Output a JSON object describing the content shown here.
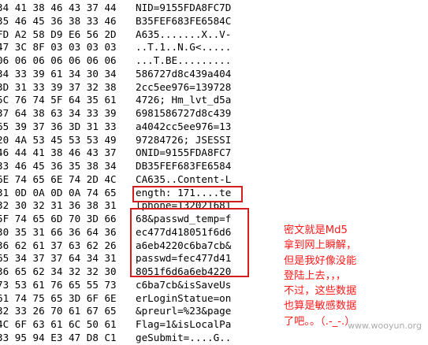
{
  "hex_rows": [
    {
      "hex": "34 41 38 46 43 37 44",
      "ascii": "NID=9155FDA8FC7D"
    },
    {
      "hex": "35 46 45 36 38 33 46",
      "ascii": "B35FEF683FE6584C"
    },
    {
      "hex": "FD A2 58 D9 E6 56 2D",
      "ascii": "A635.......X..V-"
    },
    {
      "hex": "47 3C 8F 03 03 03 03",
      "ascii": "..T.1..N.G<....."
    },
    {
      "hex": "06 06 06 06 06 06 06",
      "ascii": "...T.BE........."
    },
    {
      "hex": "34 33 39 61 34 30 34",
      "ascii": "586727d8c439a404"
    },
    {
      "hex": "3D 31 33 39 37 32 38",
      "ascii": "2cc5ee976=139728"
    },
    {
      "hex": "5C 76 74 5F 64 35 61",
      "ascii": "4726; Hm_lvt_d5a"
    },
    {
      "hex": "37 64 38 63 34 33 39",
      "ascii": "6981586727d8c439"
    },
    {
      "hex": "65 39 37 36 3D 31 33",
      "ascii": "a4042cc5ee976=13"
    },
    {
      "hex": "20 4A 53 45 53 53 49",
      "ascii": "97284726; JSESSI"
    },
    {
      "hex": "46 44 41 38 46 43 37",
      "ascii": "ONID=9155FDA8FC7"
    },
    {
      "hex": "33 46 45 36 35 38 34",
      "ascii": "DB35FEF683FE6584"
    },
    {
      "hex": "6E 74 65 6E 74 2D 4C",
      "ascii": "CA635..Content-L"
    },
    {
      "hex": "31 0D 0A 0D 0A 74 65",
      "ascii": "ength: 171....te"
    },
    {
      "hex": "32 30 32 31 36 38 31",
      "ascii": "lphone=132021681"
    },
    {
      "hex": "5F 74 65 6D 70 3D 66",
      "ascii": "68&passwd_temp=f"
    },
    {
      "hex": "30 35 31 66 36 64 36",
      "ascii": "ec477d418051f6d6"
    },
    {
      "hex": "36 62 61 37 63 62 26",
      "ascii": "a6eb4220c6ba7cb&"
    },
    {
      "hex": "65 34 37 37 64 34 31",
      "ascii": "passwd=fec477d41"
    },
    {
      "hex": "36 65 62 34 32 32 30",
      "ascii": "8051f6d6a6eb4220"
    },
    {
      "hex": "73 53 61 76 65 55 73",
      "ascii": "c6ba7cb&isSaveUs"
    },
    {
      "hex": "61 74 75 65 3D 6F 6E",
      "ascii": "erLoginStatue=on"
    },
    {
      "hex": "32 33 26 70 61 67 65",
      "ascii": "&preurl=%23&page"
    },
    {
      "hex": "4C 6F 63 61 6C 50 61",
      "ascii": "Flag=1&isLocalPa"
    },
    {
      "hex": "33 95 94 E3 47 D8 C1",
      "ascii": "geSubmit=....G.."
    }
  ],
  "annotation_lines": [
    "密文就是Md5",
    "拿到网上瞬解，",
    "但是我好像没能",
    "登陆上去，，，",
    "不过，这些数据",
    "也算是敏感数据",
    "了吧。。（.-_-.）"
  ],
  "watermark": "www.wooyun.org",
  "colors": {
    "annotation": "#ff1a1a",
    "box": "#d21e1e",
    "text": "#000000"
  }
}
